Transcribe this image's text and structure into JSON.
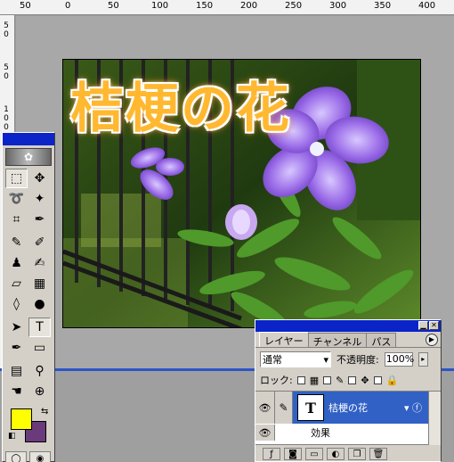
{
  "ruler": {
    "top_labels": [
      "50",
      "0",
      "50",
      "100",
      "150",
      "200",
      "250",
      "300",
      "350",
      "400"
    ],
    "left_labels": [
      "5",
      "0",
      "5",
      "0",
      "1",
      "0",
      "0"
    ]
  },
  "image": {
    "title_text": "桔梗の花"
  },
  "tools": {
    "items": [
      {
        "name": "marquee-tool",
        "glyph": "⬚"
      },
      {
        "name": "move-tool",
        "glyph": "✥"
      },
      {
        "name": "lasso-tool",
        "glyph": "ᔕ"
      },
      {
        "name": "magic-wand-tool",
        "glyph": "✦"
      },
      {
        "name": "crop-tool",
        "glyph": "⌗"
      },
      {
        "name": "eyedropper-slice-tool",
        "glyph": "✒"
      },
      {
        "name": "brush-tool",
        "glyph": "✎"
      },
      {
        "name": "pencil-tool",
        "glyph": "✐"
      },
      {
        "name": "stamp-tool",
        "glyph": "♟"
      },
      {
        "name": "history-brush-tool",
        "glyph": "✍"
      },
      {
        "name": "eraser-tool",
        "glyph": "▱"
      },
      {
        "name": "gradient-tool",
        "glyph": "▦"
      },
      {
        "name": "blur-tool",
        "glyph": "💧"
      },
      {
        "name": "dodge-tool",
        "glyph": "●"
      },
      {
        "name": "path-select-tool",
        "glyph": "➤"
      },
      {
        "name": "type-tool",
        "glyph": "T"
      },
      {
        "name": "pen-tool",
        "glyph": "✒"
      },
      {
        "name": "shape-tool",
        "glyph": "▭"
      },
      {
        "name": "notes-tool",
        "glyph": "▤"
      },
      {
        "name": "eyedropper-tool",
        "glyph": "⚲"
      },
      {
        "name": "hand-tool",
        "glyph": "✋"
      },
      {
        "name": "zoom-tool",
        "glyph": "🔍"
      }
    ],
    "foreground_color": "#ffff00",
    "background_color": "#6b3a7a"
  },
  "layers_panel": {
    "tabs": [
      "レイヤー",
      "チャンネル",
      "パス"
    ],
    "blend_mode": "通常",
    "opacity_label": "不透明度:",
    "opacity_value": "100%",
    "lock_label": "ロック:",
    "layer": {
      "thumb_glyph": "T",
      "name": "桔梗の花"
    },
    "effects_label": "効果"
  }
}
